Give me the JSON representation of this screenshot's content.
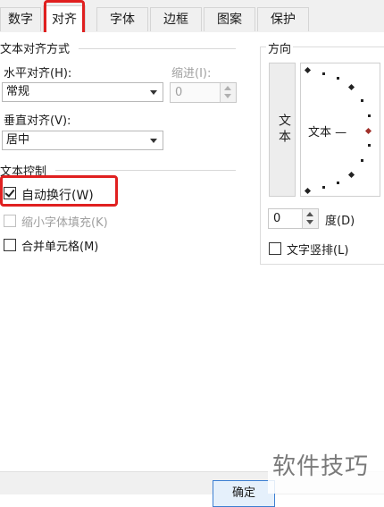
{
  "tabs": [
    {
      "id": "number",
      "label": "数字",
      "active": false
    },
    {
      "id": "alignment",
      "label": "对齐",
      "active": true
    },
    {
      "id": "font",
      "label": "字体",
      "active": false
    },
    {
      "id": "border",
      "label": "边框",
      "active": false
    },
    {
      "id": "pattern",
      "label": "图案",
      "active": false
    },
    {
      "id": "protection",
      "label": "保护",
      "active": false
    }
  ],
  "text_alignment": {
    "group_title": "文本对齐方式",
    "horizontal_label": "水平对齐(H):",
    "horizontal_value": "常规",
    "indent_label": "缩进(I):",
    "indent_value": "0",
    "vertical_label": "垂直对齐(V):",
    "vertical_value": "居中"
  },
  "text_control": {
    "group_title": "文本控制",
    "wrap_text": {
      "label": "自动换行(W)",
      "checked": true,
      "enabled": true
    },
    "shrink_to_fit": {
      "label": "缩小字体填充(K)",
      "checked": false,
      "enabled": false
    },
    "merge_cells": {
      "label": "合并单元格(M)",
      "checked": false,
      "enabled": true
    }
  },
  "orientation": {
    "group_title": "方向",
    "vertical_text_button": "文本",
    "dial_text": "文本 —",
    "degree_value": "0",
    "degree_label": "度(D)",
    "stacked_text": {
      "label": "文字竖排(L)",
      "checked": false
    }
  },
  "footer": {
    "ok_partial": "确定"
  },
  "watermark": "软件技巧",
  "colors": {
    "highlight": "#e02020",
    "dial_marker": "#a0302a"
  }
}
